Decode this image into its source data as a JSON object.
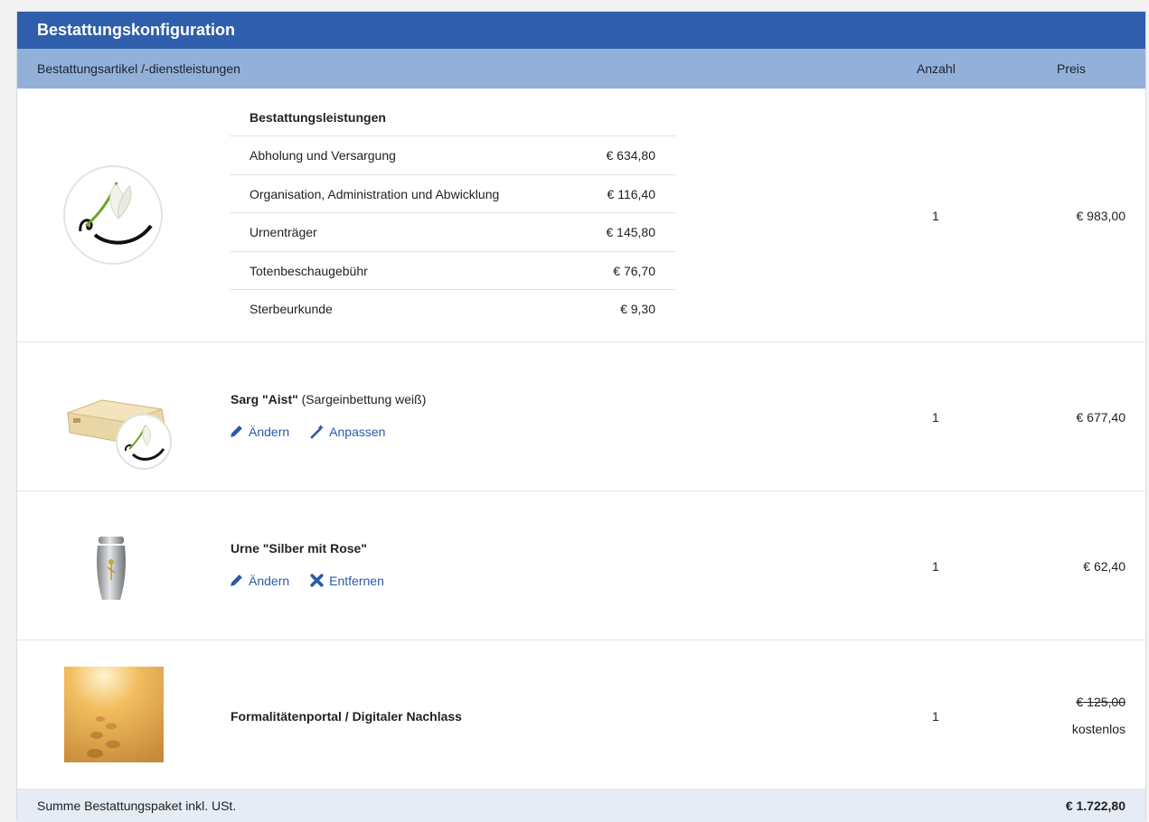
{
  "panel": {
    "title": "Bestattungskonfiguration",
    "columns": {
      "item": "Bestattungsartikel /-dienstleistungen",
      "qty": "Anzahl",
      "price": "Preis"
    }
  },
  "services": {
    "title": "Bestattungsleistungen",
    "lines": [
      {
        "label": "Abholung und Versargung",
        "price": "€ 634,80"
      },
      {
        "label": "Organisation, Administration und Abwicklung",
        "price": "€ 116,40"
      },
      {
        "label": "Urnenträger",
        "price": "€ 145,80"
      },
      {
        "label": "Totenbeschaugebühr",
        "price": "€ 76,70"
      },
      {
        "label": "Sterbeurkunde",
        "price": "€ 9,30"
      }
    ],
    "qty": "1",
    "price": "€ 983,00"
  },
  "sarg": {
    "name": "Sarg \"Aist\"",
    "detail": "(Sargeinbettung weiß)",
    "edit_label": "Ändern",
    "customize_label": "Anpassen",
    "qty": "1",
    "price": "€ 677,40"
  },
  "urne": {
    "name": "Urne \"Silber mit Rose\"",
    "edit_label": "Ändern",
    "remove_label": "Entfernen",
    "qty": "1",
    "price": "€ 62,40"
  },
  "portal": {
    "name": "Formalitätenportal / Digitaler Nachlass",
    "qty": "1",
    "old_price": "€ 125,00",
    "price": "kostenlos"
  },
  "footer": {
    "label": "Summe Bestattungspaket inkl. USt.",
    "total": "€ 1.722,80"
  },
  "colors": {
    "title_bar": "#2f5eac",
    "column_header": "#93b0d9",
    "link": "#2b5aa8",
    "footer": "#e6ecf5"
  },
  "icons": [
    "lily-logo-icon",
    "coffin-icon",
    "urn-icon",
    "footprints-image",
    "pencil-icon",
    "wand-icon",
    "remove-icon"
  ]
}
